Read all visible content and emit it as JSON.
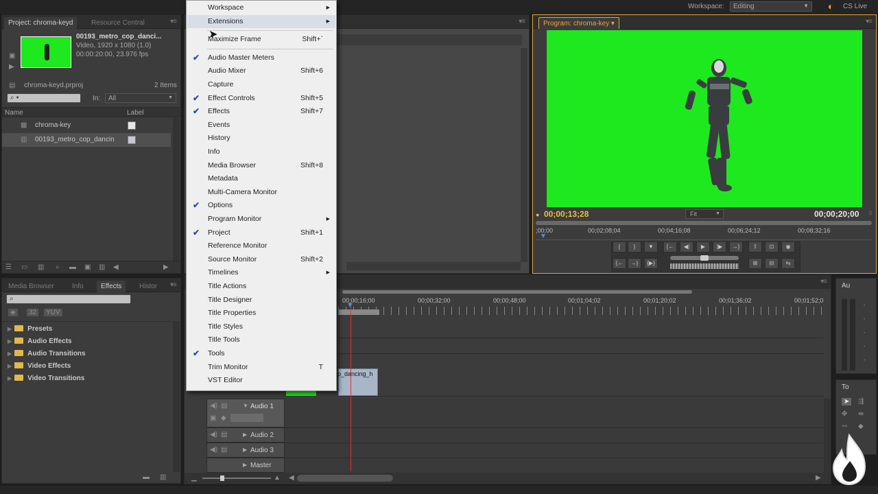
{
  "topbar": {
    "workspace_label": "Workspace:",
    "workspace_value": "Editing",
    "cslive": "CS Live"
  },
  "project_panel": {
    "tabs": [
      "Project: chroma-keyd",
      "Resource Central"
    ],
    "clip_name": "00193_metro_cop_danci...",
    "clip_info1": "Video, 1920 x 1080 (1.0)",
    "clip_info2": "00:00:20:00, 23.976 fps",
    "project_file": "chroma-keyd.prproj",
    "item_count": "2 Items",
    "in_label": "In:",
    "in_value": "All",
    "col_name": "Name",
    "col_label": "Label",
    "items": [
      "chroma-key",
      "00193_metro_cop_dancin"
    ]
  },
  "effects_panel": {
    "tabs": [
      "Media Browser",
      "Info",
      "Effects",
      "Histor"
    ],
    "folders": [
      "Presets",
      "Audio Effects",
      "Audio Transitions",
      "Video Effects",
      "Video Transitions"
    ]
  },
  "program_monitor": {
    "tab": "Program: chroma-key",
    "timecode_current": "00;00;13;28",
    "fit": "Fit",
    "timecode_duration": "00;00;20;00",
    "ruler": [
      ";00;00",
      "00;02;08;04",
      "00;04;16;08",
      "00;06;24;12",
      "00;08;32;16"
    ],
    "green": "#1ee81e"
  },
  "timeline": {
    "ruler": [
      "00;00;16;00",
      "00;00;32;00",
      "00;00;48;00",
      "00;01;04;02",
      "00;01;20;02",
      "00;01;36;02",
      "00;01;52;0"
    ],
    "clip_label": "p_dancing_h",
    "audio_tracks": [
      "Audio 1",
      "Audio 2",
      "Audio 3",
      "Master"
    ]
  },
  "right_panels": {
    "audio_tab": "Au",
    "tools_tab": "To"
  },
  "menu": {
    "items": [
      {
        "label": "Workspace",
        "shortcut": "",
        "check": false,
        "submenu": true,
        "hl": false
      },
      {
        "label": "Extensions",
        "shortcut": "",
        "check": false,
        "submenu": true,
        "hl": true
      },
      {
        "label": "Maximize Frame",
        "shortcut": "Shift+`",
        "check": false,
        "submenu": false,
        "hl": false
      },
      {
        "label": "Audio Master Meters",
        "shortcut": "",
        "check": true,
        "submenu": false,
        "hl": false
      },
      {
        "label": "Audio Mixer",
        "shortcut": "Shift+6",
        "check": false,
        "submenu": false,
        "hl": false
      },
      {
        "label": "Capture",
        "shortcut": "",
        "check": false,
        "submenu": false,
        "hl": false
      },
      {
        "label": "Effect Controls",
        "shortcut": "Shift+5",
        "check": true,
        "submenu": false,
        "hl": false
      },
      {
        "label": "Effects",
        "shortcut": "Shift+7",
        "check": true,
        "submenu": false,
        "hl": false
      },
      {
        "label": "Events",
        "shortcut": "",
        "check": false,
        "submenu": false,
        "hl": false
      },
      {
        "label": "History",
        "shortcut": "",
        "check": false,
        "submenu": false,
        "hl": false
      },
      {
        "label": "Info",
        "shortcut": "",
        "check": false,
        "submenu": false,
        "hl": false
      },
      {
        "label": "Media Browser",
        "shortcut": "Shift+8",
        "check": false,
        "submenu": false,
        "hl": false
      },
      {
        "label": "Metadata",
        "shortcut": "",
        "check": false,
        "submenu": false,
        "hl": false
      },
      {
        "label": "Multi-Camera Monitor",
        "shortcut": "",
        "check": false,
        "submenu": false,
        "hl": false
      },
      {
        "label": "Options",
        "shortcut": "",
        "check": true,
        "submenu": false,
        "hl": false
      },
      {
        "label": "Program Monitor",
        "shortcut": "",
        "check": false,
        "submenu": true,
        "hl": false
      },
      {
        "label": "Project",
        "shortcut": "Shift+1",
        "check": true,
        "submenu": false,
        "hl": false
      },
      {
        "label": "Reference Monitor",
        "shortcut": "",
        "check": false,
        "submenu": false,
        "hl": false
      },
      {
        "label": "Source Monitor",
        "shortcut": "Shift+2",
        "check": false,
        "submenu": false,
        "hl": false
      },
      {
        "label": "Timelines",
        "shortcut": "",
        "check": false,
        "submenu": true,
        "hl": false
      },
      {
        "label": "Title Actions",
        "shortcut": "",
        "check": false,
        "submenu": false,
        "hl": false
      },
      {
        "label": "Title Designer",
        "shortcut": "",
        "check": false,
        "submenu": false,
        "hl": false
      },
      {
        "label": "Title Properties",
        "shortcut": "",
        "check": false,
        "submenu": false,
        "hl": false
      },
      {
        "label": "Title Styles",
        "shortcut": "",
        "check": false,
        "submenu": false,
        "hl": false
      },
      {
        "label": "Title Tools",
        "shortcut": "",
        "check": false,
        "submenu": false,
        "hl": false
      },
      {
        "label": "Tools",
        "shortcut": "",
        "check": true,
        "submenu": false,
        "hl": false
      },
      {
        "label": "Trim Monitor",
        "shortcut": "T",
        "check": false,
        "submenu": false,
        "hl": false
      },
      {
        "label": "VST Editor",
        "shortcut": "",
        "check": false,
        "submenu": false,
        "hl": false
      }
    ]
  }
}
